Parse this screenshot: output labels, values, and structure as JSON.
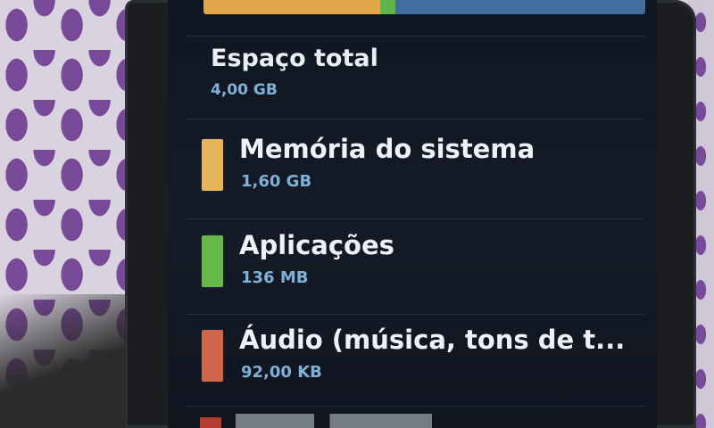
{
  "storage": {
    "total_label": "Espaço total",
    "total_value": "4,00 GB",
    "usage_bar": [
      {
        "name": "system",
        "fraction": 0.4,
        "color": "#e0a84a"
      },
      {
        "name": "applications",
        "fraction": 0.034,
        "color": "#5fb54a"
      },
      {
        "name": "free",
        "fraction": 0.566,
        "color": "#3f6e9c"
      }
    ],
    "items": [
      {
        "label": "Memória do sistema",
        "value": "1,60 GB",
        "color": "#e6b45a"
      },
      {
        "label": "Aplicações",
        "value": "136 MB",
        "color": "#68b84a"
      },
      {
        "label": "Áudio (música, tons de t...",
        "value": "92,00 KB",
        "color": "#d0674a"
      }
    ]
  }
}
